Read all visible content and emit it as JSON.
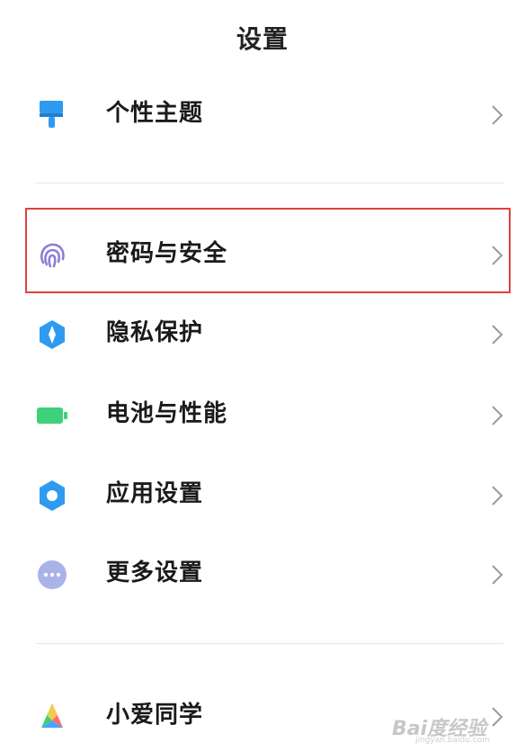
{
  "header": {
    "title": "设置"
  },
  "items": [
    {
      "label": "个性主题",
      "icon": "paintbrush-icon"
    },
    {
      "label": "密码与安全",
      "icon": "fingerprint-icon"
    },
    {
      "label": "隐私保护",
      "icon": "privacy-shield-icon"
    },
    {
      "label": "电池与性能",
      "icon": "battery-icon"
    },
    {
      "label": "应用设置",
      "icon": "gear-icon"
    },
    {
      "label": "更多设置",
      "icon": "more-dots-icon"
    },
    {
      "label": "小爱同学",
      "icon": "xiaoai-logo-icon"
    }
  ],
  "colors": {
    "highlight_border": "#e04040",
    "theme_blue": "#2e9bf0",
    "fingerprint_purple": "#8a7fd6",
    "battery_green": "#3dd17a",
    "more_lavender": "#a9b3e8"
  },
  "watermark": {
    "brand": "Bai度经验",
    "url": "jingyan.baidu.com"
  }
}
